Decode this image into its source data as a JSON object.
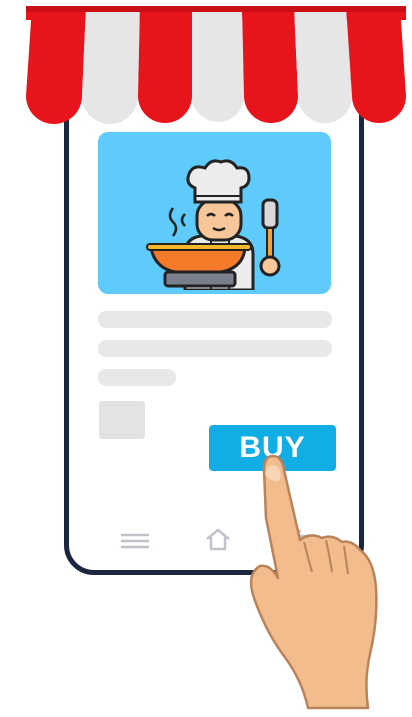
{
  "buy_button": {
    "label": "BUY"
  },
  "icons": {
    "awning": "striped-awning-icon",
    "chef": "chef-cooking-icon",
    "hand": "pointing-hand-icon",
    "nav_menu": "menu-icon",
    "nav_home": "home-icon",
    "nav_back": "back-icon"
  },
  "colors": {
    "awning_red": "#e8141b",
    "awning_white": "#e6e6e6",
    "hero_background": "#5fcbfb",
    "buy_button": "#11aee6",
    "phone_frame": "#1b2740",
    "skin": "#f2bc8d"
  }
}
